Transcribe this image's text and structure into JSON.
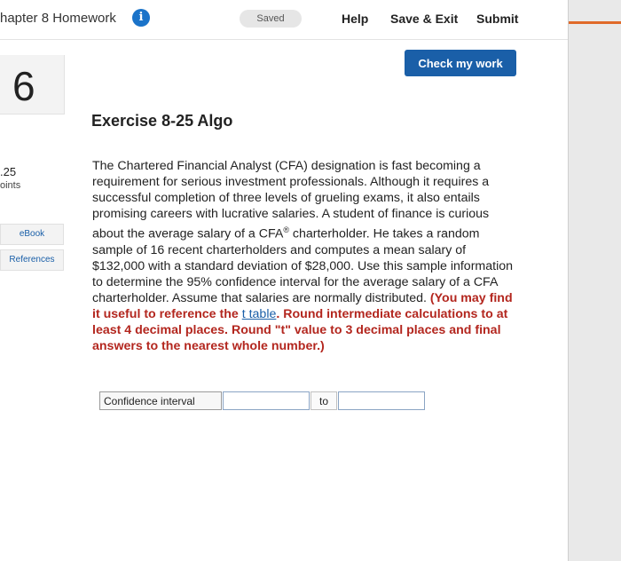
{
  "header": {
    "title": "hapter 8 Homework",
    "info_icon": "i",
    "saved": "Saved",
    "help": "Help",
    "save_exit": "Save & Exit",
    "submit": "Submit"
  },
  "check_label": "Check my work",
  "question": {
    "number": "6",
    "points_value": ".25",
    "points_label": "oints",
    "ebook": "eBook",
    "references": "References"
  },
  "exercise": {
    "title": "Exercise 8-25 Algo",
    "text_1": "The Chartered Financial Analyst (CFA) designation is fast becoming a requirement for serious investment professionals. Although it requires a successful completion of three levels of grueling exams, it also entails promising careers with lucrative salaries. A student of finance is curious about the average salary of a CFA",
    "registered": "®",
    "text_2": " charterholder. He takes a random sample of 16 recent charterholders and computes a mean salary of $132,000 with a standard deviation of $28,000. Use this sample information to determine the 95% confidence interval for the average salary of a CFA charterholder. Assume that salaries are normally distributed. ",
    "red_1": "(You may find it useful to reference the ",
    "link": "t table",
    "red_2": ". Round intermediate calculations to at least 4 decimal places. Round \"t\" value to 3 decimal places and final answers to the nearest whole number.)"
  },
  "answer": {
    "label": "Confidence interval",
    "to": "to",
    "lower_value": "",
    "upper_value": ""
  },
  "colors": {
    "accent": "#1a5fa8",
    "info": "#1a73c9",
    "instruction_red": "#b3261e",
    "gutter_stripe": "#e06a2a"
  }
}
